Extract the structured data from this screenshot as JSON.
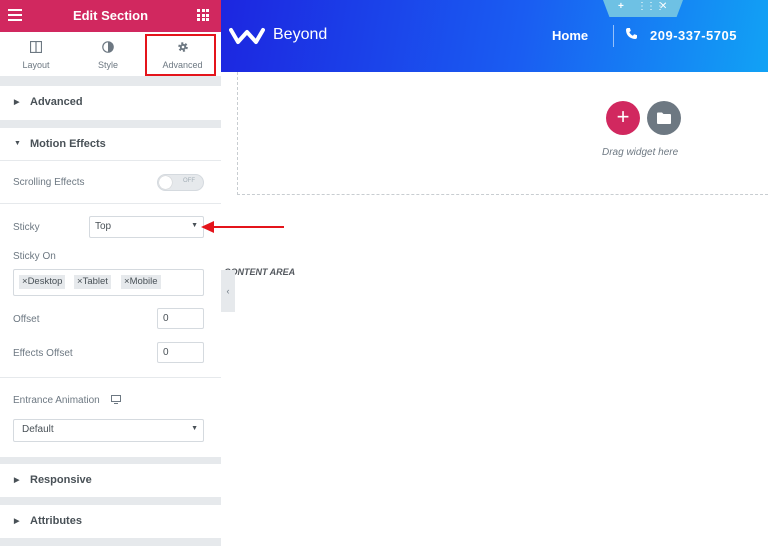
{
  "sidebar": {
    "title": "Edit Section",
    "tabs": [
      {
        "label": "Layout",
        "icon": "columns-icon"
      },
      {
        "label": "Style",
        "icon": "half-circle-icon"
      },
      {
        "label": "Advanced",
        "icon": "gear-icon"
      }
    ],
    "sections": {
      "advanced": "Advanced",
      "motion_effects": "Motion Effects",
      "responsive": "Responsive",
      "attributes": "Attributes"
    },
    "motion": {
      "scrolling_effects_label": "Scrolling Effects",
      "scrolling_toggle": "OFF",
      "sticky_label": "Sticky",
      "sticky_value": "Top",
      "sticky_on_label": "Sticky On",
      "sticky_on_values": [
        "Desktop",
        "Tablet",
        "Mobile"
      ],
      "offset_label": "Offset",
      "offset_value": "0",
      "effects_offset_label": "Effects Offset",
      "effects_offset_value": "0",
      "entrance_animation_label": "Entrance Animation",
      "entrance_animation_value": "Default"
    }
  },
  "site": {
    "brand": "Beyond",
    "nav_home": "Home",
    "phone": "209-337-5705"
  },
  "canvas": {
    "drag_hint": "Drag widget here",
    "content_label": "CONTENT AREA"
  },
  "colors": {
    "editor_accent": "#d1285f",
    "highlight": "#e4141b",
    "header_gradient_start": "#1c26e0",
    "header_gradient_end": "#11a2f5"
  }
}
